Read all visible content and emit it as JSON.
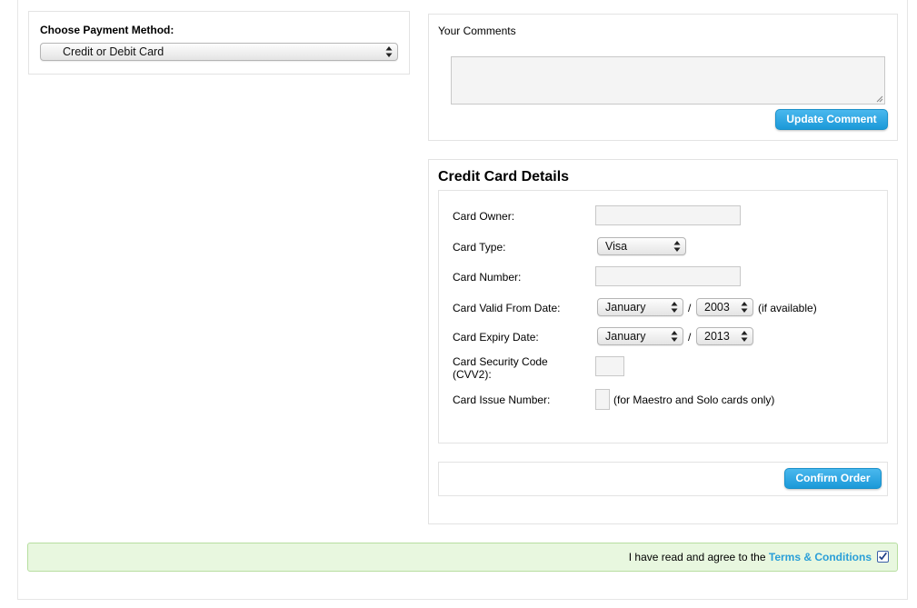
{
  "payment": {
    "label": "Choose Payment Method:",
    "selected": "Credit or Debit Card"
  },
  "comments": {
    "label": "Your Comments",
    "value": "",
    "update_button": "Update Comment"
  },
  "card": {
    "title": "Credit Card Details",
    "owner_label": "Card Owner:",
    "owner_value": "",
    "type_label": "Card Type:",
    "type_selected": "Visa",
    "number_label": "Card Number:",
    "number_value": "",
    "valid_from_label": "Card Valid From Date:",
    "valid_from_month": "January",
    "valid_from_year": "2003",
    "valid_from_note": "(if available)",
    "expiry_label": "Card Expiry Date:",
    "expiry_month": "January",
    "expiry_year": "2013",
    "date_separator": "/",
    "cvv_label_line1": "Card Security Code",
    "cvv_label_line2": "(CVV2):",
    "cvv_value": "",
    "issue_label": "Card Issue Number:",
    "issue_value": "",
    "issue_note": "(for Maestro and Solo cards only)",
    "confirm_button": "Confirm Order"
  },
  "terms": {
    "text": "I have read and agree to the ",
    "link": "Terms & Conditions",
    "checked": true
  }
}
